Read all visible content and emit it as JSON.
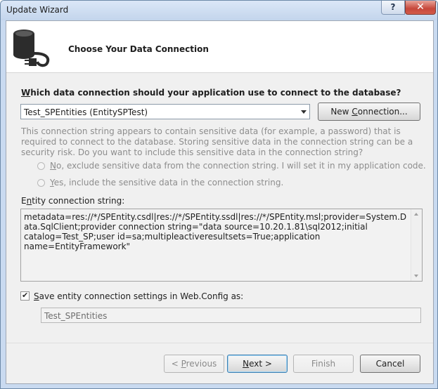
{
  "window": {
    "title": "Update Wizard",
    "help_label": "?",
    "close_label": "✕"
  },
  "header": {
    "title": "Choose Your Data Connection",
    "icon": "database-plug-icon"
  },
  "question": {
    "prefix": "",
    "accel": "W",
    "rest": "hich data connection should your application use to connect to the database?"
  },
  "connection": {
    "selected": "Test_SPEntities (EntitySPTest)",
    "new_button_pre": "New ",
    "new_button_accel": "C",
    "new_button_post": "onnection..."
  },
  "sensitive": {
    "warning": "This connection string appears to contain sensitive data (for example, a password) that is required to connect to the database. Storing sensitive data in the connection string can be a security risk. Do you want to include this sensitive data in the connection string?",
    "option_no_accel": "N",
    "option_no_rest": "o, exclude sensitive data from the connection string. I will set it in my application code.",
    "option_yes_accel": "Y",
    "option_yes_rest": "es, include the sensitive data in the connection string."
  },
  "entity": {
    "label_pre": "E",
    "label_accel": "n",
    "label_post": "tity connection string:",
    "value": "metadata=res://*/SPEntity.csdl|res://*/SPEntity.ssdl|res://*/SPEntity.msl;provider=System.Data.SqlClient;provider connection string=\"data source=10.20.1.81\\sql2012;initial catalog=Test_SP;user id=sa;multipleactiveresultsets=True;application name=EntityFramework\""
  },
  "save": {
    "checked": true,
    "accel": "S",
    "rest": "ave entity connection settings in Web.Config as:",
    "value": "Test_SPEntities"
  },
  "buttons": {
    "previous_pre": "< ",
    "previous_accel": "P",
    "previous_post": "revious",
    "next_accel": "N",
    "next_post": "ext >",
    "finish": "Finish",
    "cancel": "Cancel"
  }
}
